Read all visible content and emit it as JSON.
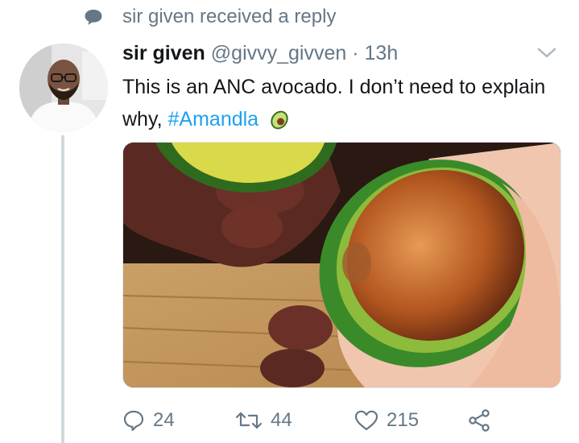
{
  "context": {
    "icon": "reply-bubble-icon",
    "text": "sir given received a reply"
  },
  "tweet": {
    "author_name": "sir given",
    "handle": "@givvy_givven",
    "separator": "·",
    "time": "13h",
    "text_plain": "This is an ANC avocado. I don’t need to explain why,",
    "hashtag": "#Amandla",
    "emoji": "avocado-emoji",
    "media_icon": "avocado-photo"
  },
  "actions": {
    "replies": "24",
    "retweets": "44",
    "likes": "215"
  },
  "colors": {
    "link": "#1da1f2",
    "muted": "#657786",
    "thread_line": "#cfd9de"
  }
}
